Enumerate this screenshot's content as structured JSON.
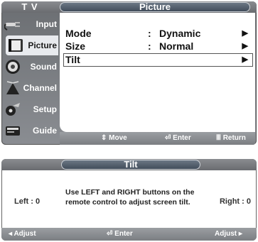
{
  "menu": {
    "app_label": "T V",
    "title": "Picture",
    "sidebar": [
      {
        "label": "Input",
        "icon": "input-plug-icon"
      },
      {
        "label": "Picture",
        "icon": "picture-icon"
      },
      {
        "label": "Sound",
        "icon": "speaker-icon"
      },
      {
        "label": "Channel",
        "icon": "antenna-icon"
      },
      {
        "label": "Setup",
        "icon": "gear-icon"
      },
      {
        "label": "Guide",
        "icon": "guide-icon"
      }
    ],
    "rows": [
      {
        "label": "Mode",
        "colon": ":",
        "value": "Dynamic",
        "arrow": "▶"
      },
      {
        "label": "Size",
        "colon": ":",
        "value": "Normal",
        "arrow": "▶"
      },
      {
        "label": "Tilt",
        "colon": "",
        "value": "",
        "arrow": "▶"
      }
    ],
    "help": {
      "move": "Move",
      "enter": "Enter",
      "return": "Return"
    }
  },
  "tilt_dialog": {
    "title": "Tilt",
    "left_label": "Left",
    "left_value": ": 0",
    "right_label": "Right",
    "right_value": ": 0",
    "message_line1": "Use LEFT and RIGHT buttons on the",
    "message_line2": "remote control to adjust screen tilt.",
    "help": {
      "adjust_left": "Adjust",
      "enter": "Enter",
      "adjust_right": "Adjust"
    }
  },
  "colors": {
    "frame": "#7b7e82",
    "title_pill": "#4a5665",
    "content": "#ffffff"
  }
}
